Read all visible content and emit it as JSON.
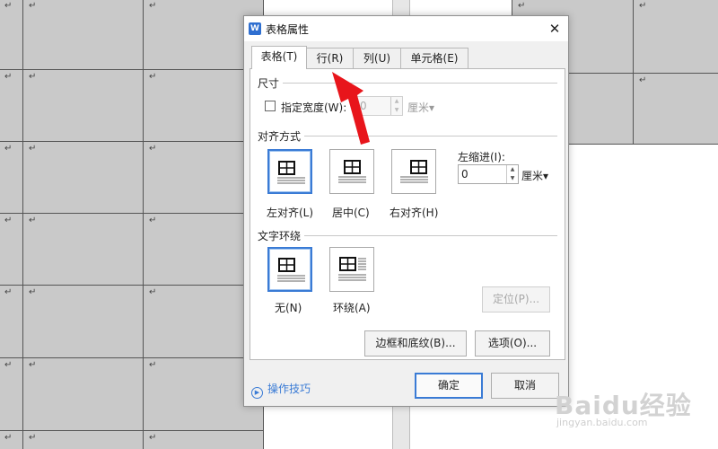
{
  "document": {
    "paragraph_mark": "↵"
  },
  "dialog": {
    "title": "表格属性",
    "app_icon_letter": "W",
    "close_glyph": "✕",
    "tabs": [
      {
        "label": "表格(T)",
        "active": true
      },
      {
        "label": "行(R)",
        "active": false
      },
      {
        "label": "列(U)",
        "active": false
      },
      {
        "label": "单元格(E)",
        "active": false
      }
    ],
    "size": {
      "section_title": "尺寸",
      "checkbox_label": "指定宽度(W):",
      "checked": false,
      "width_value": "0",
      "unit": "厘米▾"
    },
    "alignment": {
      "section_title": "对齐方式",
      "options": [
        {
          "label": "左对齐(L)",
          "selected": true,
          "icon": "table-align-left-icon"
        },
        {
          "label": "居中(C)",
          "selected": false,
          "icon": "table-align-center-icon"
        },
        {
          "label": "右对齐(H)",
          "selected": false,
          "icon": "table-align-right-icon"
        }
      ],
      "indent_label": "左缩进(I):",
      "indent_value": "0",
      "indent_unit": "厘米▾"
    },
    "wrapping": {
      "section_title": "文字环绕",
      "options": [
        {
          "label": "无(N)",
          "selected": true,
          "icon": "wrap-none-icon"
        },
        {
          "label": "环绕(A)",
          "selected": false,
          "icon": "wrap-around-icon"
        }
      ],
      "position_button": "定位(P)..."
    },
    "borders_button": "边框和底纹(B)...",
    "options_button": "选项(O)...",
    "tips_label": "操作技巧",
    "ok_button": "确定",
    "cancel_button": "取消"
  },
  "annotation": {
    "arrow_color": "#e8151b",
    "target": "行(R)"
  },
  "watermark": {
    "main": "Baidu经验",
    "sub": "jingyan.baidu.com"
  },
  "colors": {
    "accent": "#3a7bd5",
    "cell_fill": "#c9c9c9"
  }
}
